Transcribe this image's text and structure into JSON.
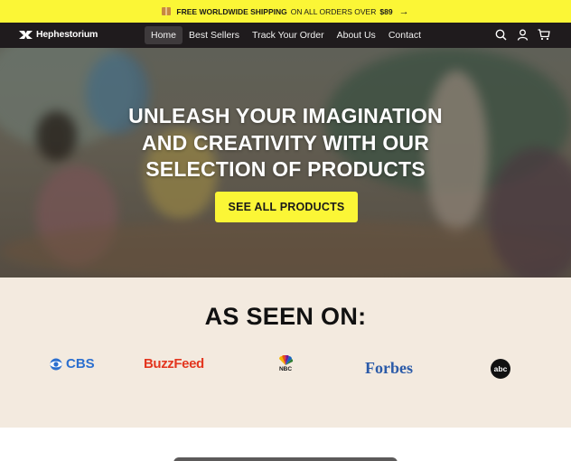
{
  "announcement": {
    "bold_text": "FREE WORLDWIDE SHIPPING",
    "text": "ON ALL ORDERS OVER",
    "amount": "$89",
    "arrow": "→"
  },
  "nav": {
    "brand": "Hephestorium",
    "items": [
      {
        "label": "Home",
        "active": true
      },
      {
        "label": "Best Sellers"
      },
      {
        "label": "Track Your Order"
      },
      {
        "label": "About Us"
      },
      {
        "label": "Contact"
      }
    ],
    "icons": [
      "search-icon",
      "account-icon",
      "cart-icon"
    ]
  },
  "hero": {
    "title_lines": [
      "UNLEASH YOUR IMAGINATION",
      "AND CREATIVITY WITH OUR",
      "SELECTION OF PRODUCTS"
    ],
    "cta_label": "SEE ALL PRODUCTS"
  },
  "press": {
    "title": "AS SEEN ON:",
    "brands": [
      "CBS",
      "BuzzFeed",
      "NBC",
      "Forbes",
      "abc"
    ]
  },
  "colors": {
    "accent": "#fbf636",
    "nav_bg": "#1f1b1d",
    "press_bg": "#f3eadf",
    "cbs": "#2b6fcf",
    "buzzfeed": "#e3361f",
    "forbes": "#2a5aa8"
  }
}
